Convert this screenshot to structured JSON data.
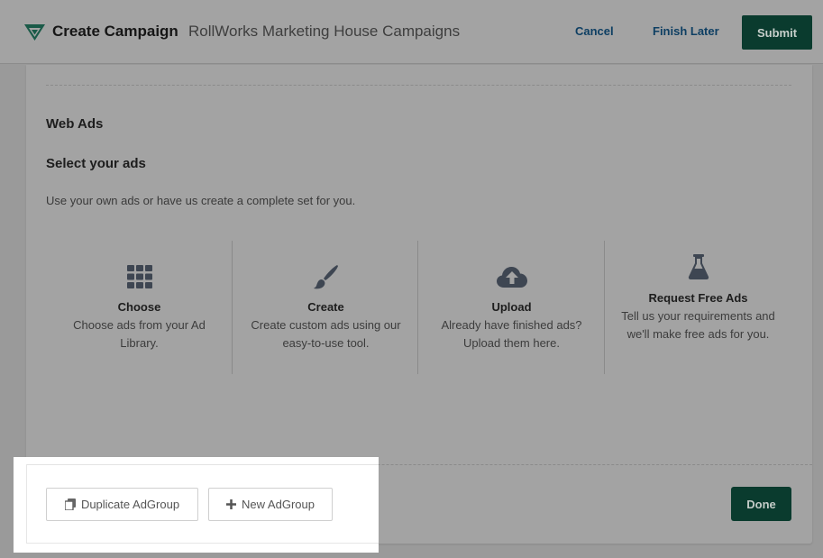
{
  "header": {
    "logo_icon": "rollworks-logo-icon",
    "title": "Create Campaign",
    "subtitle": "RollWorks Marketing House Campaigns",
    "cancel_label": "Cancel",
    "finish_later_label": "Finish Later",
    "submit_label": "Submit"
  },
  "main": {
    "section_title": "Web Ads",
    "select_title": "Select your ads",
    "description": "Use your own ads or have us create a complete set for you.",
    "options": [
      {
        "icon": "grid-icon",
        "label": "Choose",
        "text": "Choose ads from your Ad Library."
      },
      {
        "icon": "paintbrush-icon",
        "label": "Create",
        "text": "Create custom ads using our easy-to-use tool."
      },
      {
        "icon": "cloud-upload-icon",
        "label": "Upload",
        "text": "Already have finished ads? Upload them here."
      },
      {
        "icon": "flask-icon",
        "label": "Request Free Ads",
        "text": "Tell us your requirements and we'll make free ads for you."
      }
    ]
  },
  "footer": {
    "duplicate_label": "Duplicate AdGroup",
    "new_label": "New AdGroup",
    "done_label": "Done"
  },
  "colors": {
    "brand_dark_green": "#0a3b2e",
    "link_blue": "#0e3f63",
    "overlay_gray": "#a3a3a3",
    "logo_green": "#1a5a48"
  }
}
